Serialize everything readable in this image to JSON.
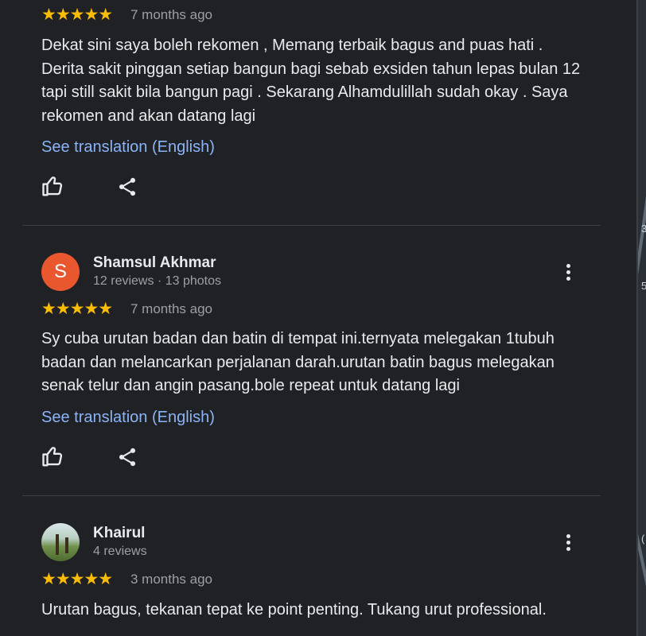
{
  "reviews": [
    {
      "name": "",
      "meta": "",
      "stars": "★★★★★",
      "time": "7 months ago",
      "text": "Dekat sini saya boleh rekomen , Memang terbaik bagus and puas hati . Derita sakit pinggan setiap bangun bagi sebab exsiden tahun lepas bulan 12 tapi still sakit bila bangun pagi . Sekarang Alhamdulillah sudah okay . Saya rekomen and akan datang lagi",
      "translate": "See translation (English)"
    },
    {
      "name": "Shamsul Akhmar",
      "initial": "S",
      "meta": "12 reviews · 13 photos",
      "stars": "★★★★★",
      "time": "7 months ago",
      "text": "Sy cuba urutan badan dan batin di tempat ini.ternyata melegakan 1tubuh badan dan melancarkan perjalanan darah.urutan batin bagus melegakan senak telur dan angin pasang.bole repeat untuk datang lagi",
      "translate": "See translation (English)"
    },
    {
      "name": "Khairul",
      "meta": "4 reviews",
      "stars": "★★★★★",
      "time": "3 months ago",
      "text": "Urutan bagus, tekanan tepat ke point penting. Tukang urut professional."
    }
  ],
  "map_edge_labels": [
    "3",
    "5",
    "("
  ],
  "colors": {
    "background": "#202124",
    "star": "#fbbc04",
    "link": "#8ab4f8",
    "avatar_s": "#e8572e"
  },
  "icons": [
    "thumbs-up-icon",
    "share-icon",
    "more-vert-icon",
    "star-icon"
  ]
}
